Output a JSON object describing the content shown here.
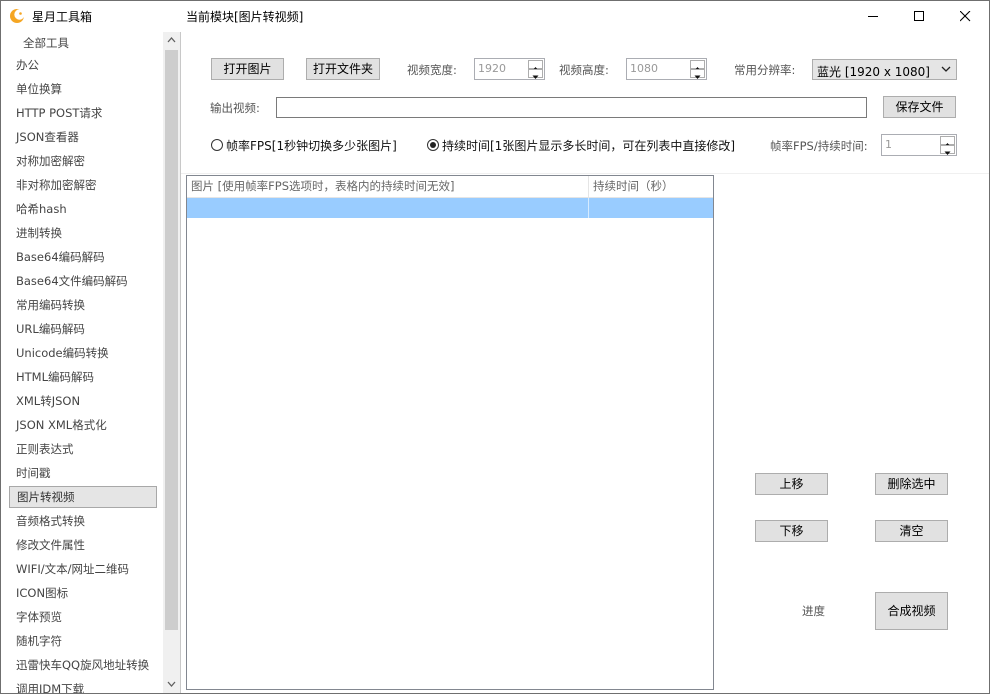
{
  "app": {
    "title": "星月工具箱",
    "module_title": "当前模块[图片转视频]"
  },
  "window_buttons": [
    "minimize-icon",
    "maximize-icon",
    "close-icon"
  ],
  "sidebar": {
    "root": "全部工具",
    "items": [
      {
        "label": "办公"
      },
      {
        "label": "单位换算"
      },
      {
        "label": "HTTP POST请求"
      },
      {
        "label": "JSON查看器"
      },
      {
        "label": "对称加密解密"
      },
      {
        "label": "非对称加密解密"
      },
      {
        "label": "哈希hash"
      },
      {
        "label": "进制转换"
      },
      {
        "label": "Base64编码解码"
      },
      {
        "label": "Base64文件编码解码"
      },
      {
        "label": "常用编码转换"
      },
      {
        "label": "URL编码解码"
      },
      {
        "label": "Unicode编码转换"
      },
      {
        "label": "HTML编码解码"
      },
      {
        "label": "XML转JSON"
      },
      {
        "label": "JSON XML格式化"
      },
      {
        "label": "正则表达式"
      },
      {
        "label": "时间戳"
      },
      {
        "label": "图片转视频",
        "selected": true
      },
      {
        "label": "音频格式转换"
      },
      {
        "label": "修改文件属性"
      },
      {
        "label": "WIFI/文本/网址二维码"
      },
      {
        "label": "ICON图标"
      },
      {
        "label": "字体预览"
      },
      {
        "label": "随机字符"
      },
      {
        "label": "迅雷快车QQ旋风地址转换"
      },
      {
        "label": "调用IDM下载"
      }
    ]
  },
  "toolbar": {
    "open_image": "打开图片",
    "open_folder": "打开文件夹",
    "width_label": "视频宽度:",
    "width_value": "1920",
    "height_label": "视频高度:",
    "height_value": "1080",
    "resolution_label": "常用分辨率:",
    "resolution_value": "蓝光 [1920 x 1080]"
  },
  "output": {
    "label": "输出视频:",
    "value": "",
    "save_button": "保存文件"
  },
  "mode": {
    "fps_option": "帧率FPS[1秒钟切换多少张图片]",
    "duration_option": "持续时间[1张图片显示多长时间，可在列表中直接修改]",
    "selected": "duration",
    "fps_duration_label": "帧率FPS/持续时间:",
    "fps_duration_value": "1"
  },
  "grid": {
    "columns": [
      "图片 [使用帧率FPS选项时，表格内的持续时间无效]",
      "持续时间（秒）"
    ],
    "rows": [
      [
        "",
        ""
      ]
    ]
  },
  "actions": {
    "move_up": "上移",
    "delete_selected": "删除选中",
    "move_down": "下移",
    "clear": "清空",
    "progress_label": "进度",
    "compose": "合成视频"
  },
  "colors": {
    "selection": "#99ccff",
    "button_bg": "#e1e1e1",
    "app_icon": "#f5a623"
  }
}
